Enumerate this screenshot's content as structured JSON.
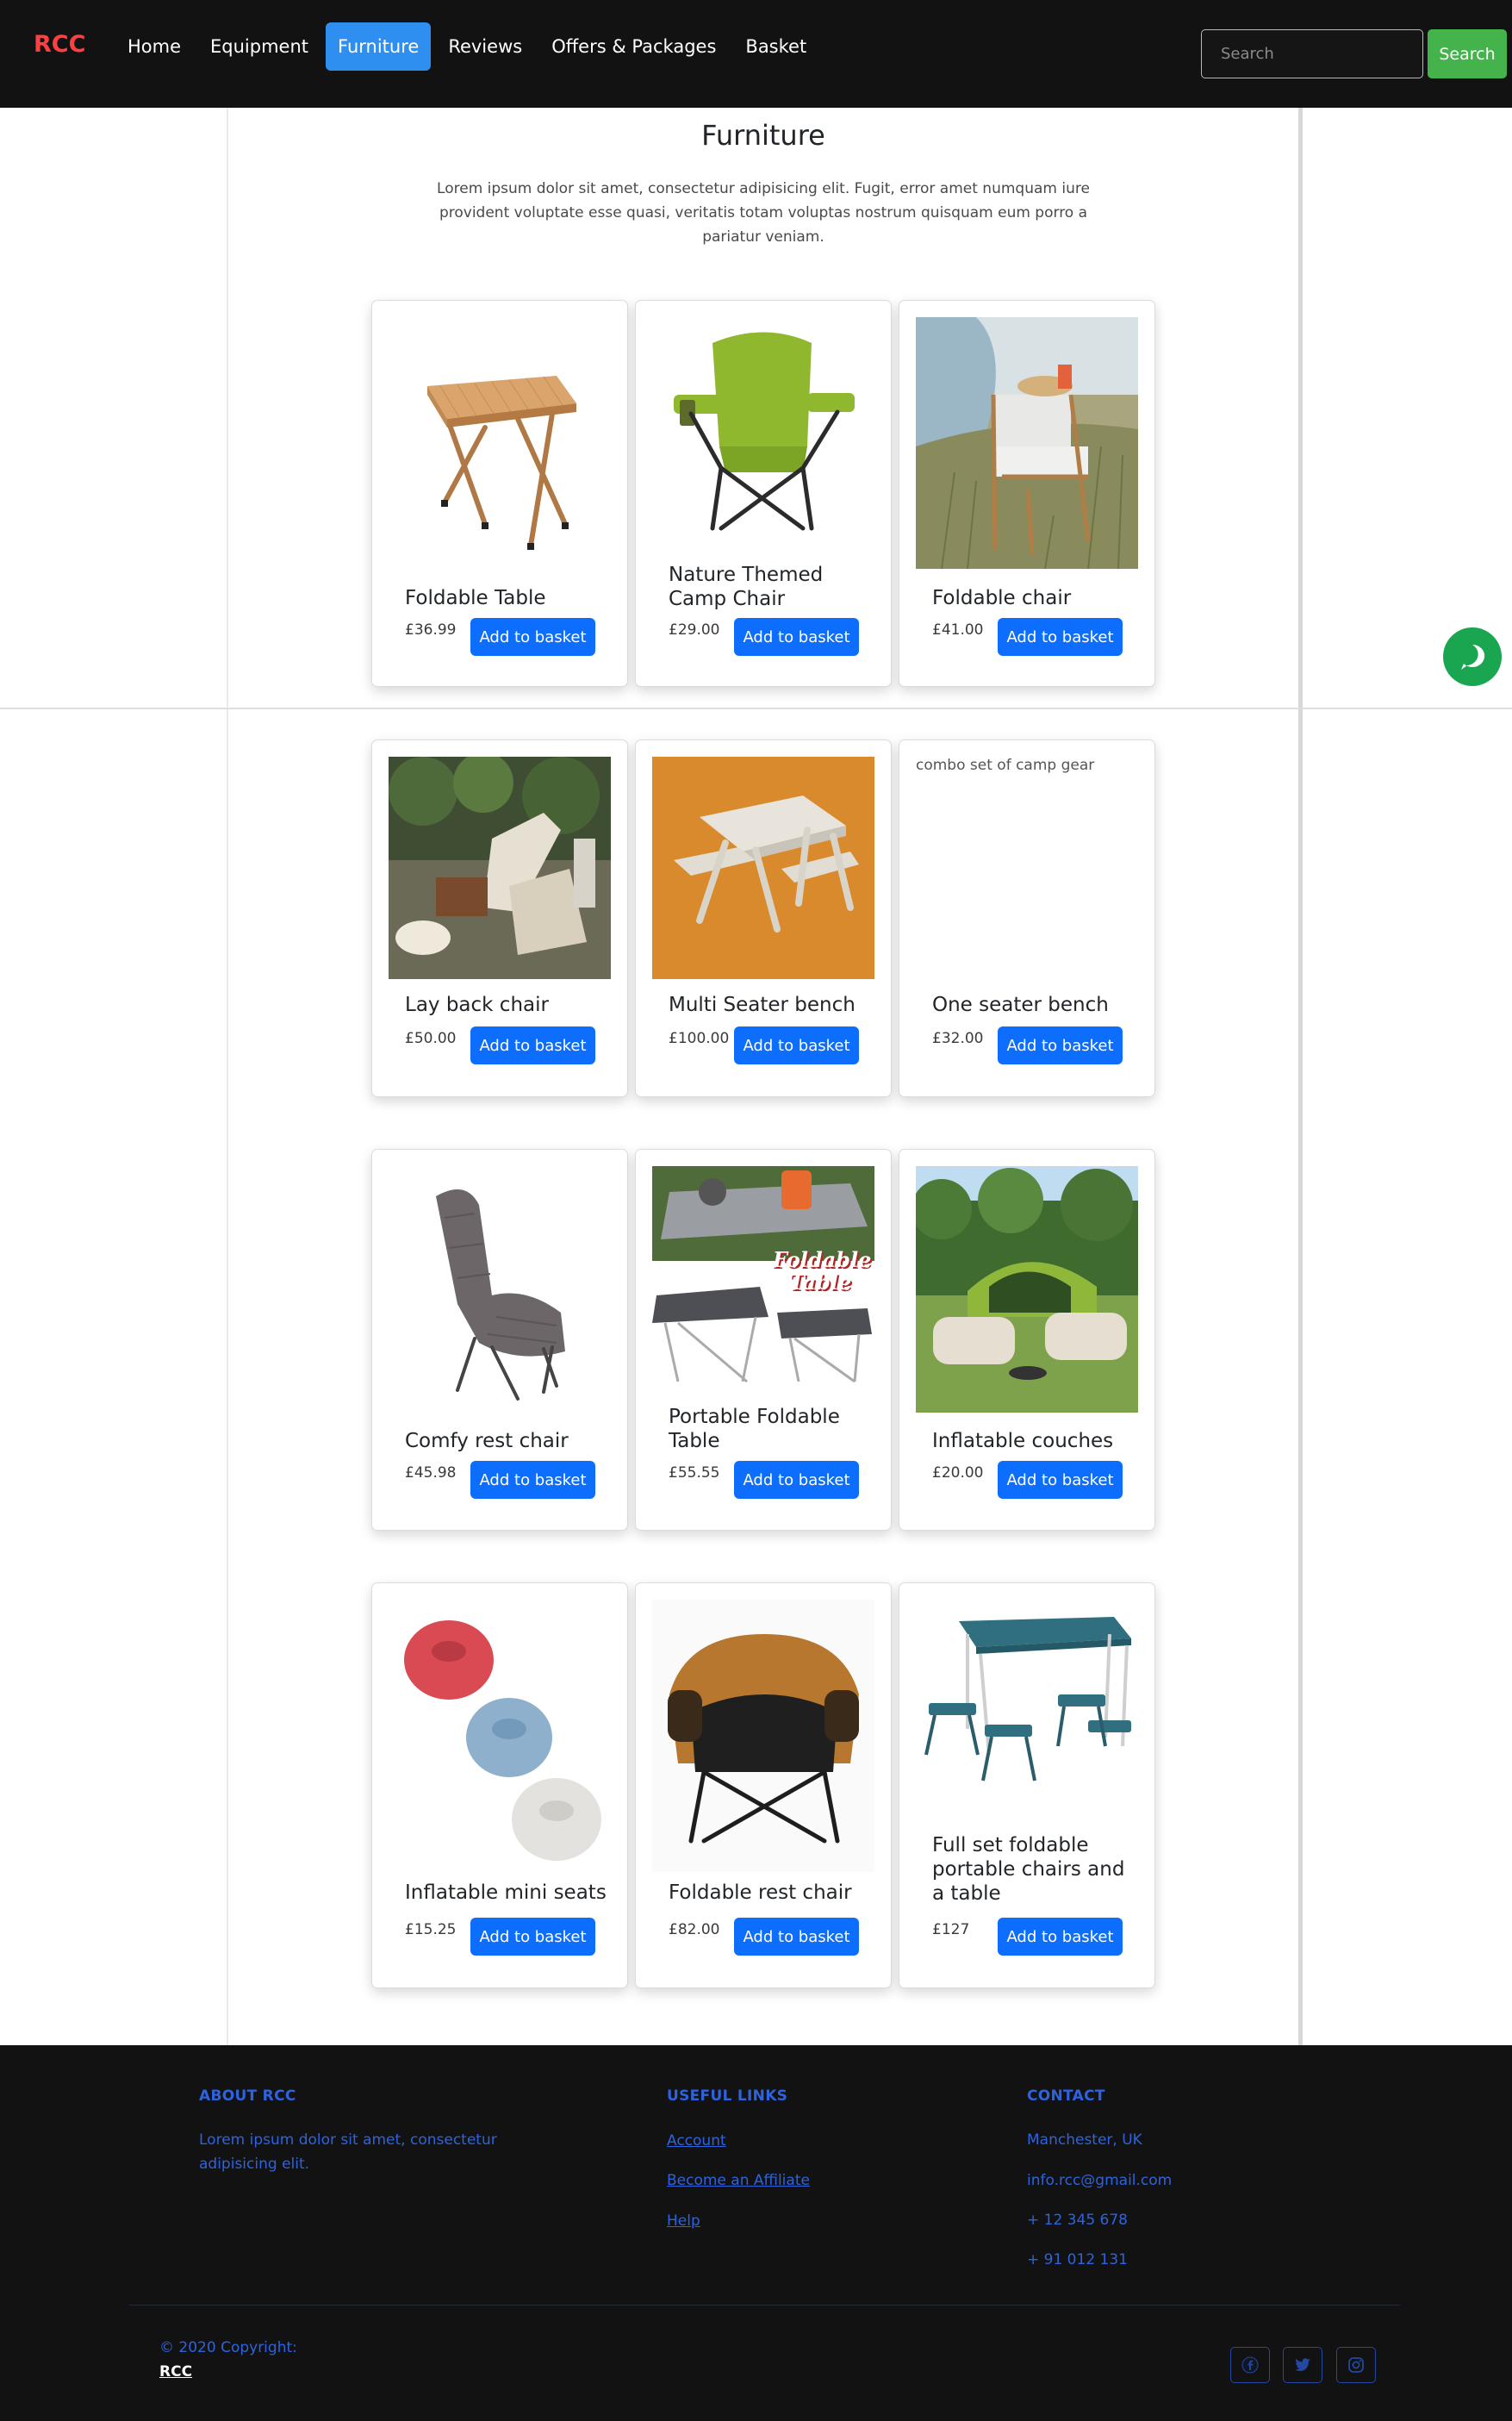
{
  "nav": {
    "brand": "RCC",
    "links": [
      "Home",
      "Equipment",
      "Furniture",
      "Reviews",
      "Offers & Packages",
      "Basket"
    ],
    "active": "Furniture",
    "search_placeholder": "Search",
    "search_button": "Search"
  },
  "header": {
    "title": "Furniture",
    "intro": "Lorem ipsum dolor sit amet, consectetur adipisicing elit. Fugit, error amet numquam iure provident voluptate esse quasi, veritatis totam voluptas nostrum quisquam eum porro a pariatur veniam."
  },
  "products": [
    {
      "name": "Foldable Table",
      "price": "£36.99",
      "button": "Add to basket"
    },
    {
      "name": "Nature Themed Camp Chair",
      "price": "£29.00",
      "button": "Add to basket"
    },
    {
      "name": "Foldable chair",
      "price": "£41.00",
      "button": "Add to basket"
    },
    {
      "name": "Lay back chair",
      "price": "£50.00",
      "button": "Add to basket"
    },
    {
      "name": "Multi Seater bench",
      "price": "£100.00",
      "button": "Add to basket"
    },
    {
      "name": "One seater bench",
      "price": "£32.00",
      "button": "Add to basket",
      "image_alt": "combo set of camp gear"
    },
    {
      "name": "Comfy rest chair",
      "price": "£45.98",
      "button": "Add to basket"
    },
    {
      "name": "Portable Foldable Table",
      "price": "£55.55",
      "button": "Add to basket",
      "image_text": "Foldable Table"
    },
    {
      "name": "Inflatable couches",
      "price": "£20.00",
      "button": "Add to basket"
    },
    {
      "name": "Inflatable mini seats",
      "price": "£15.25",
      "button": "Add to basket"
    },
    {
      "name": "Foldable rest chair",
      "price": "£82.00",
      "button": "Add to basket"
    },
    {
      "name": "Full set foldable portable chairs and a table",
      "price": "£127",
      "button": "Add to basket"
    }
  ],
  "footer": {
    "about_heading": "ABOUT RCC",
    "about_text": "Lorem ipsum dolor sit amet, consectetur adipisicing elit.",
    "links_heading": "USEFUL LINKS",
    "links": [
      "Account",
      "Become an Affiliate",
      "Help"
    ],
    "contact_heading": "CONTACT",
    "contact": [
      "Manchester, UK",
      "info.rcc@gmail.com",
      "+ 12 345 678",
      "+ 91 012 131"
    ],
    "copyright": "© 2020 Copyright:",
    "copyright_brand": "RCC"
  },
  "colors": {
    "nav_bg": "#121212",
    "brand": "#ff4040",
    "active_tab": "#2e8ff0",
    "search_button": "#44b34c",
    "primary_button": "#0d6efd",
    "footer_text": "#2d63e0",
    "chat": "#1aa551"
  },
  "icons": [
    "chat-icon",
    "facebook-icon",
    "twitter-icon",
    "instagram-icon"
  ]
}
